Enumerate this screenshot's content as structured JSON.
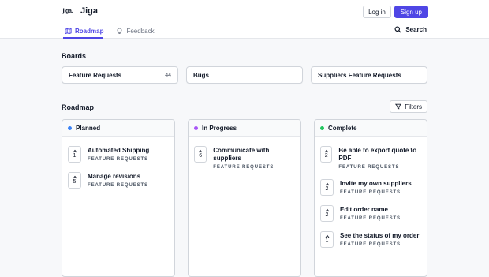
{
  "header": {
    "logo_text": "jiga.",
    "brand_name": "Jiga",
    "login_label": "Log in",
    "signup_label": "Sign up",
    "accent_color": "#4f46e5"
  },
  "nav": {
    "items": [
      {
        "label": "Roadmap",
        "icon": "map-icon",
        "active": true
      },
      {
        "label": "Feedback",
        "icon": "lightbulb-icon",
        "active": false
      }
    ],
    "search_label": "Search"
  },
  "boards": {
    "title": "Boards",
    "items": [
      {
        "name": "Feature Requests",
        "count": "44"
      },
      {
        "name": "Bugs",
        "count": ""
      },
      {
        "name": "Suppliers Feature Requests",
        "count": ""
      }
    ]
  },
  "roadmap": {
    "title": "Roadmap",
    "filters_label": "Filters",
    "columns": [
      {
        "title": "Planned",
        "color": "#3b82f6",
        "posts": [
          {
            "title": "Automated Shipping",
            "board": "FEATURE REQUESTS",
            "votes": "1"
          },
          {
            "title": "Manage revisions",
            "board": "FEATURE REQUESTS",
            "votes": "5"
          }
        ]
      },
      {
        "title": "In Progress",
        "color": "#a855f7",
        "posts": [
          {
            "title": "Communicate with suppliers",
            "board": "FEATURE REQUESTS",
            "votes": "6"
          }
        ]
      },
      {
        "title": "Complete",
        "color": "#22c55e",
        "posts": [
          {
            "title": "Be able to export quote to PDF",
            "board": "FEATURE REQUESTS",
            "votes": "2"
          },
          {
            "title": "Invite my own suppliers",
            "board": "FEATURE REQUESTS",
            "votes": "2"
          },
          {
            "title": "Edit order name",
            "board": "FEATURE REQUESTS",
            "votes": "2"
          },
          {
            "title": "See the status of my order",
            "board": "FEATURE REQUESTS",
            "votes": "1"
          }
        ]
      }
    ]
  }
}
